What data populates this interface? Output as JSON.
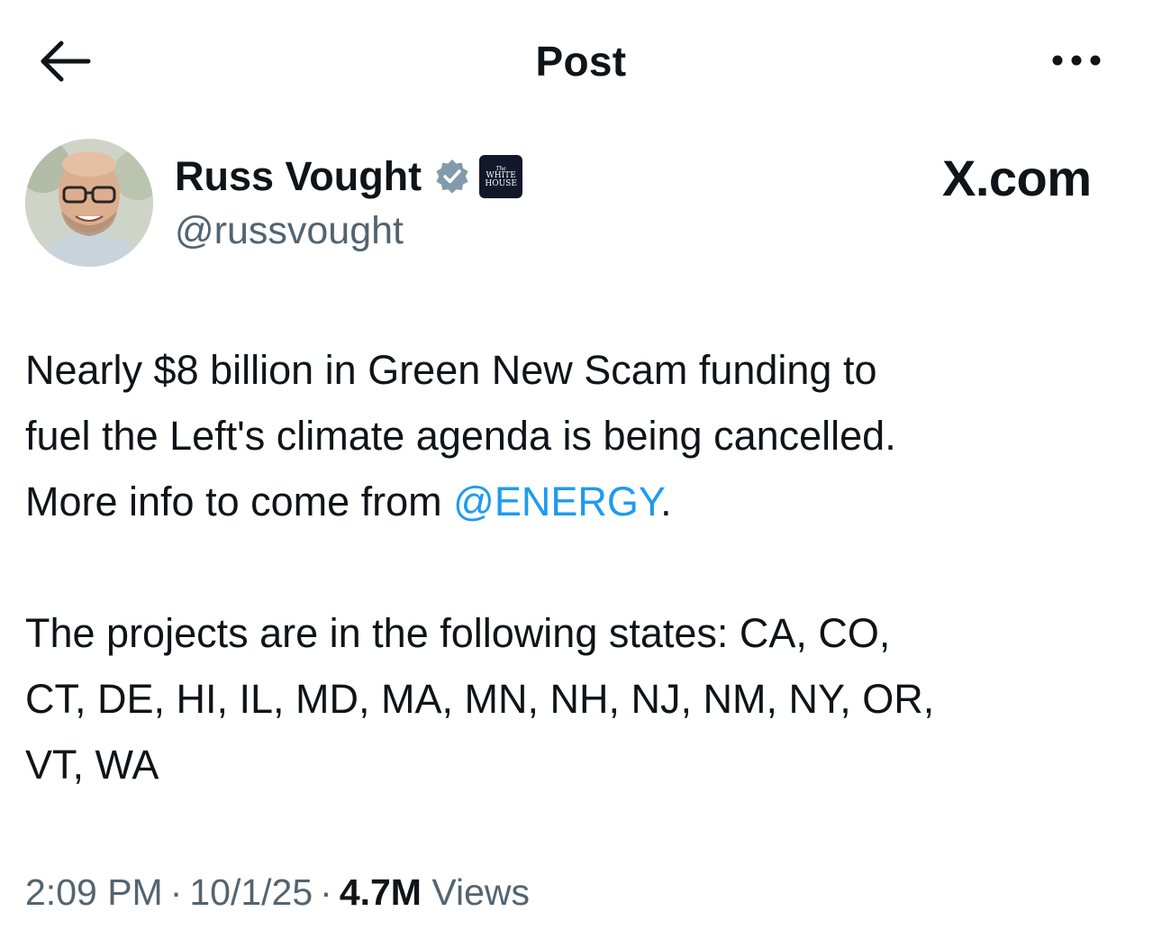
{
  "header": {
    "title": "Post",
    "back_icon": "arrow-left-icon",
    "more_icon": "more-horizontal-icon"
  },
  "author": {
    "display_name": "Russ Vought",
    "handle": "@russvought",
    "verified_badge": "verified-badge-icon",
    "affiliation_badge": {
      "line1": "The",
      "line2": "WHITE",
      "line3": "HOUSE"
    }
  },
  "watermark": "X.com",
  "post": {
    "line1_a": "Nearly $8 billion in Green New Scam funding to",
    "line1_b": "fuel the Left's climate agenda is being cancelled.",
    "line1_c_pre": "More info to come from ",
    "mention": "@ENERGY",
    "line1_c_post": ".",
    "line2_a": "The projects are in the following states: CA, CO,",
    "line2_b": "CT, DE, HI, IL, MD, MA, MN, NH, NJ, NM, NY, OR,",
    "line2_c": "VT, WA"
  },
  "meta": {
    "time": "2:09 PM",
    "date": "10/1/25",
    "separator": "·",
    "views_count": "4.7M",
    "views_label": "Views"
  },
  "colors": {
    "text": "#0f1419",
    "secondary": "#536471",
    "link": "#1d9bf0",
    "verified_gray": "#829aab"
  }
}
